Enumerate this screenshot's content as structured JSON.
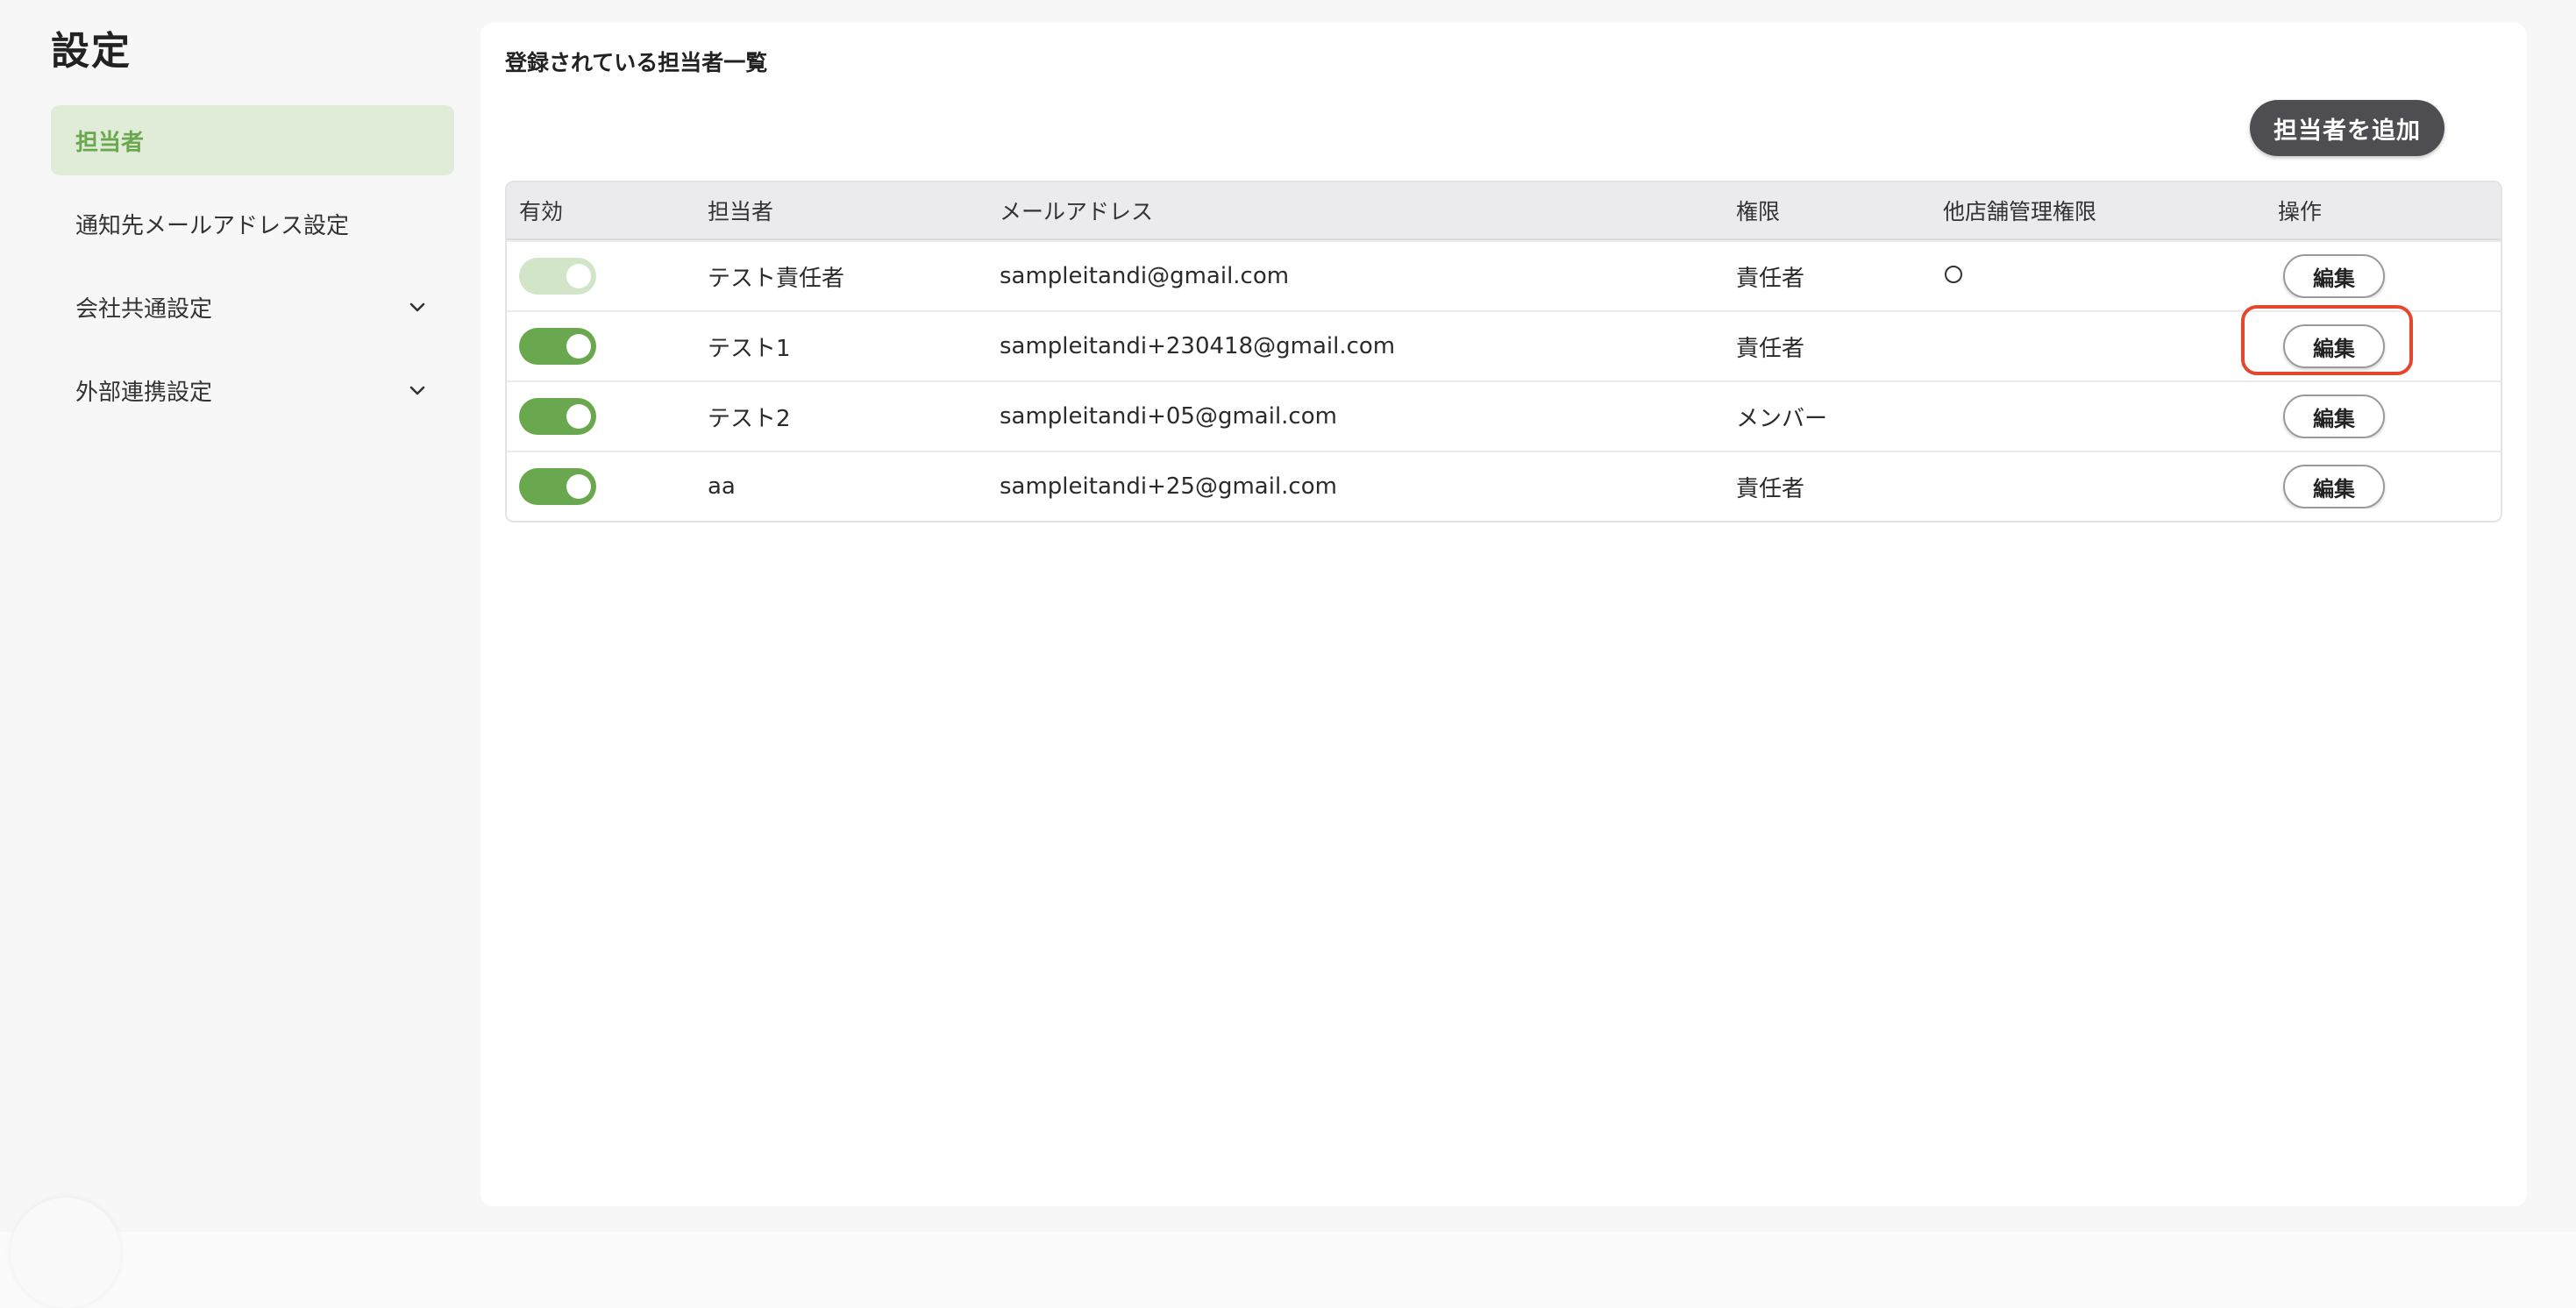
{
  "page": {
    "title": "設定"
  },
  "sidebar": {
    "items": [
      {
        "label": "担当者",
        "active": true,
        "has_chevron": false
      },
      {
        "label": "通知先メールアドレス設定",
        "active": false,
        "has_chevron": false
      },
      {
        "label": "会社共通設定",
        "active": false,
        "has_chevron": true
      },
      {
        "label": "外部連携設定",
        "active": false,
        "has_chevron": true
      }
    ]
  },
  "main": {
    "section_title": "登録されている担当者一覧",
    "add_button_label": "担当者を追加",
    "table": {
      "headers": [
        "有効",
        "担当者",
        "メールアドレス",
        "権限",
        "他店舗管理権限",
        "操作"
      ],
      "rows": [
        {
          "enabled": true,
          "toggle_disabled": true,
          "name": "テスト責任者",
          "email": "sampleitandi@gmail.com",
          "role": "責任者",
          "other_store": "○",
          "action": "編集",
          "highlighted": false
        },
        {
          "enabled": true,
          "toggle_disabled": false,
          "name": "テスト1",
          "email": "sampleitandi+230418@gmail.com",
          "role": "責任者",
          "other_store": "",
          "action": "編集",
          "highlighted": true
        },
        {
          "enabled": true,
          "toggle_disabled": false,
          "name": "テスト2",
          "email": "sampleitandi+05@gmail.com",
          "role": "メンバー",
          "other_store": "",
          "action": "編集",
          "highlighted": false
        },
        {
          "enabled": true,
          "toggle_disabled": false,
          "name": "aa",
          "email": "sampleitandi+25@gmail.com",
          "role": "責任者",
          "other_store": "",
          "action": "編集",
          "highlighted": false
        }
      ]
    }
  },
  "colors": {
    "accent_green": "#6aa84f",
    "active_bg": "#e1ecd8",
    "toggle_disabled": "#d3e5c8",
    "highlight_red": "#e4472d",
    "add_button_bg": "#4d4d52"
  },
  "icons": {
    "chevron": "chevron-down-icon",
    "toggle": "toggle-switch"
  }
}
